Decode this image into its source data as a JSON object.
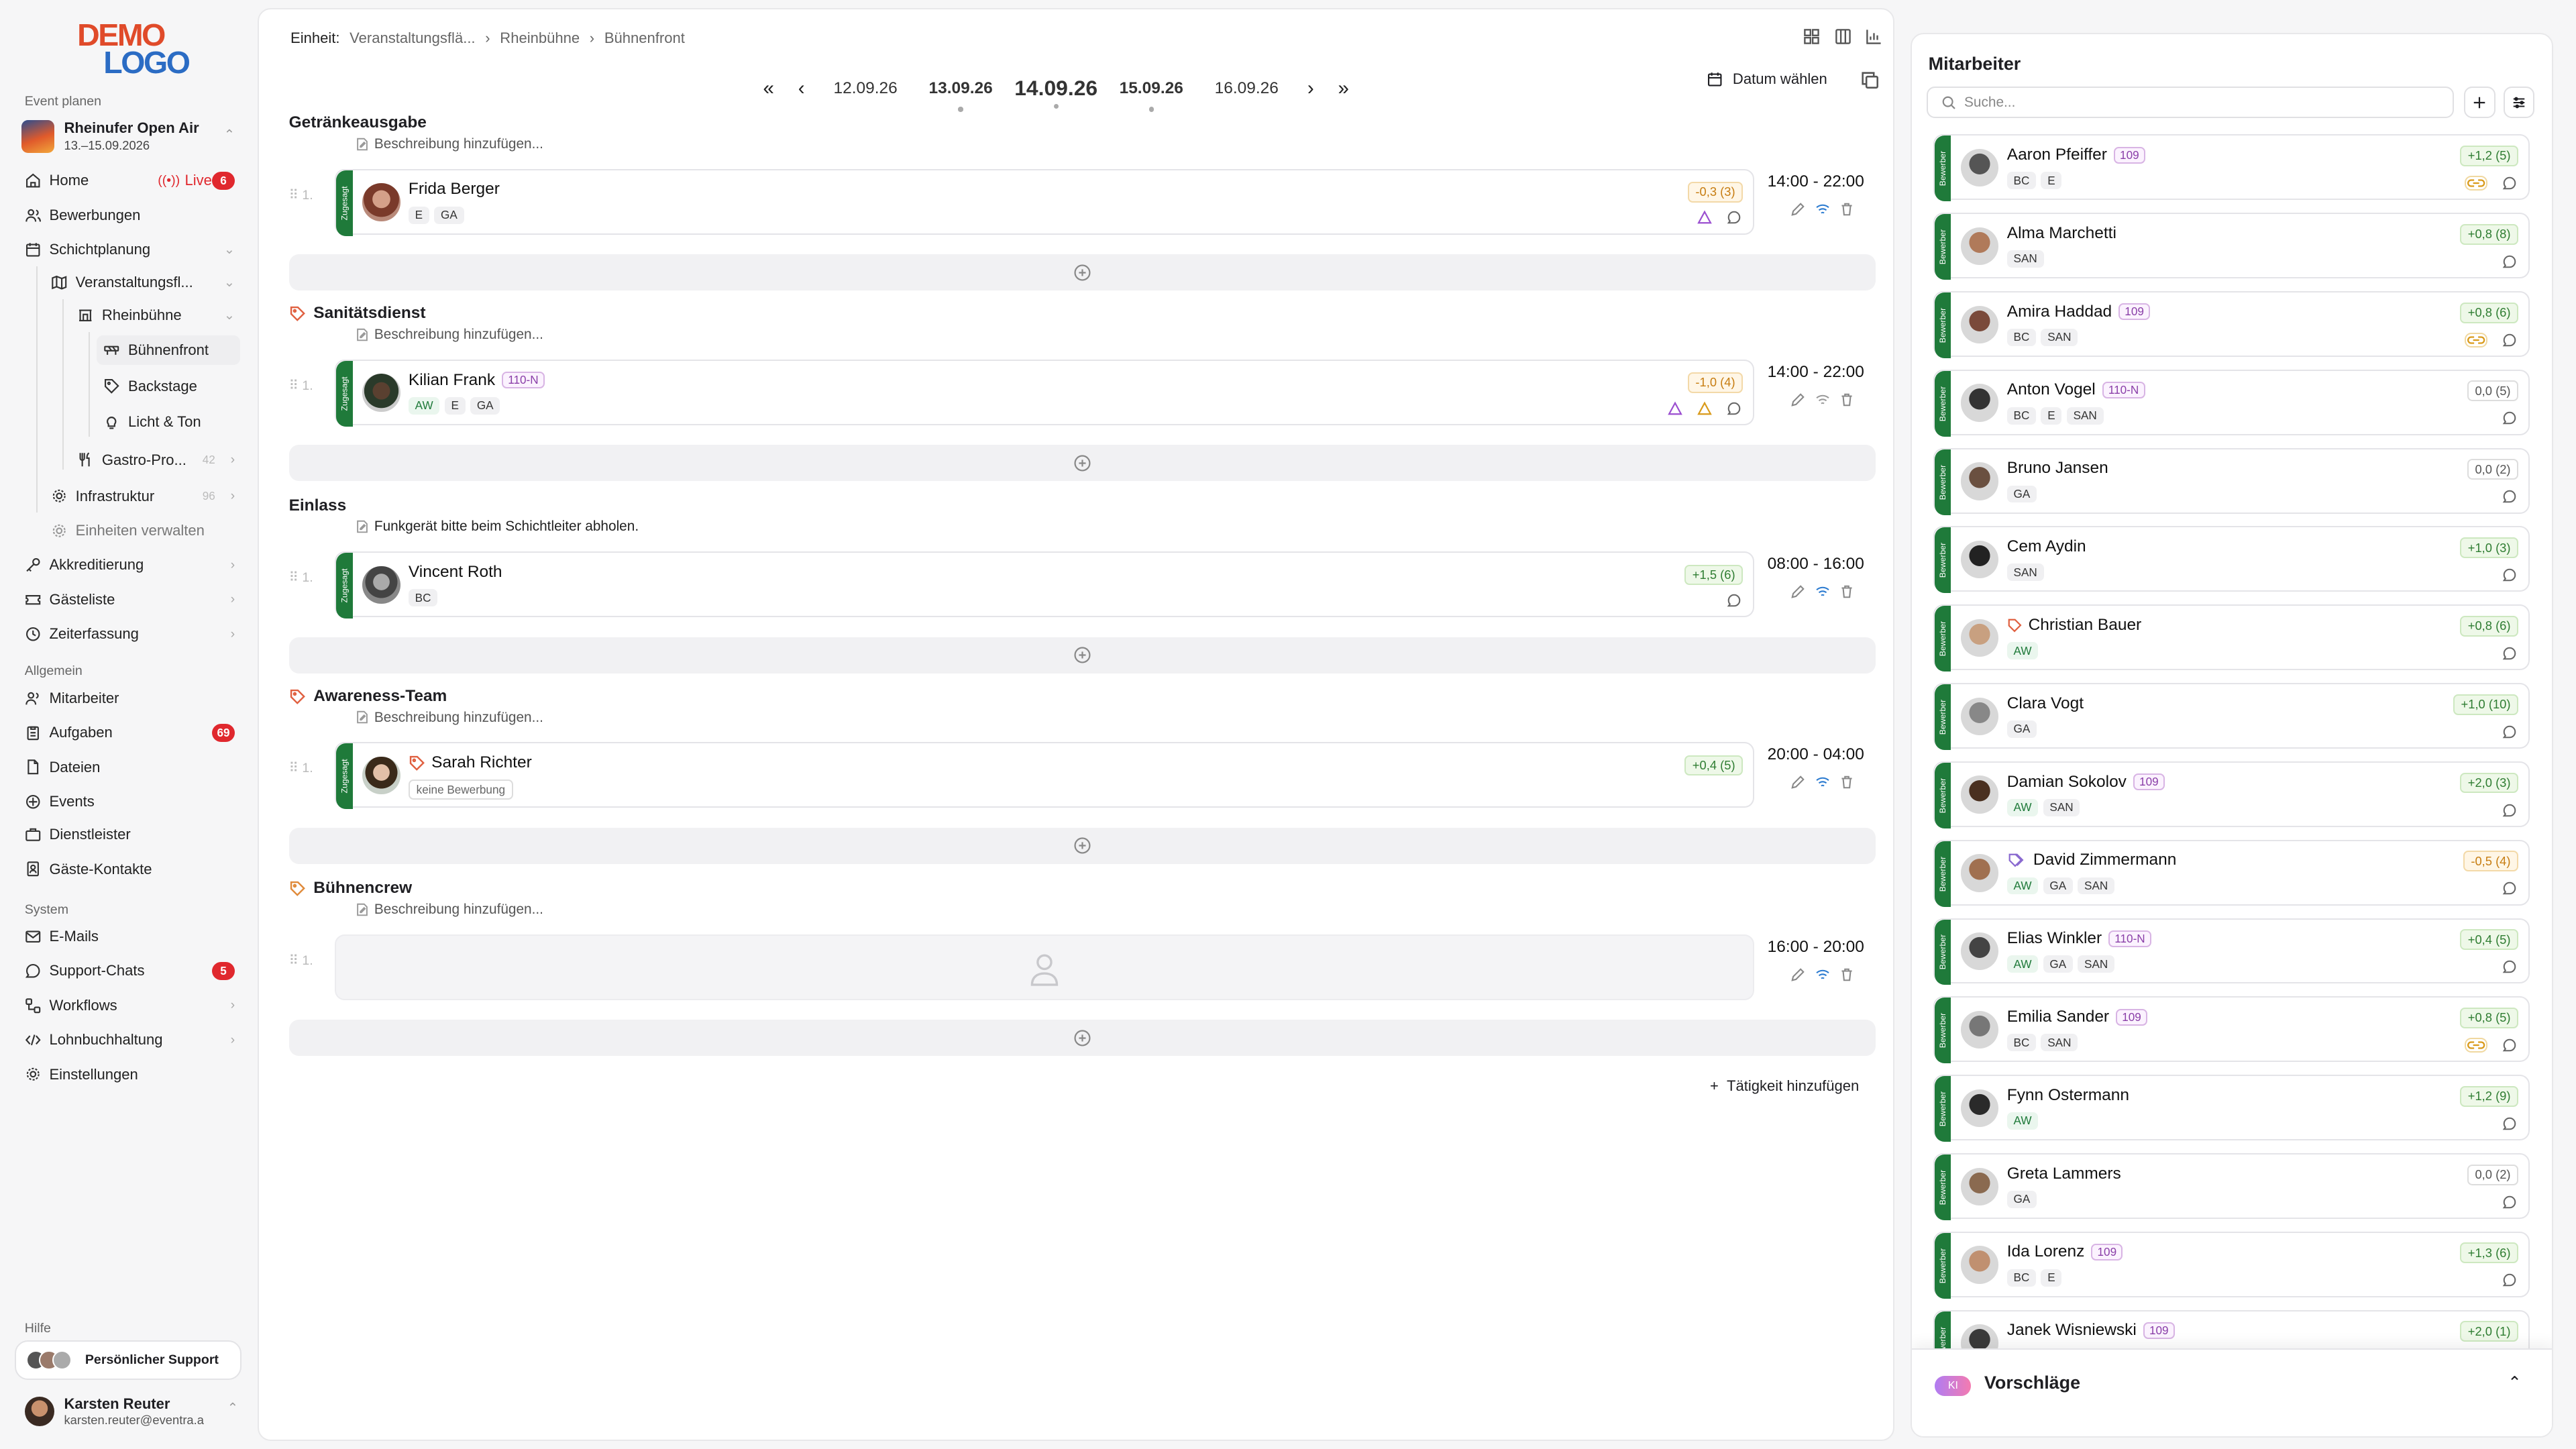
{
  "logo": {
    "line1": "DEMO",
    "line2": "LOGO"
  },
  "sidebar": {
    "plan_label": "Event planen",
    "event": {
      "title": "Rheinufer Open Air",
      "dates": "13.–15.09.2026"
    },
    "items": [
      {
        "label": "Home",
        "live": "Live",
        "badge": "6"
      },
      {
        "label": "Bewerbungen"
      },
      {
        "label": "Schichtplanung"
      },
      {
        "label": "Veranstaltungsfl..."
      },
      {
        "label": "Rheinbühne"
      },
      {
        "label": "Bühnenfront"
      },
      {
        "label": "Backstage"
      },
      {
        "label": "Licht & Ton"
      },
      {
        "label": "Gastro-Pro...",
        "count": "42"
      },
      {
        "label": "Infrastruktur",
        "count": "96"
      },
      {
        "label": "Einheiten verwalten"
      },
      {
        "label": "Akkreditierung"
      },
      {
        "label": "Gästeliste"
      },
      {
        "label": "Zeiterfassung"
      }
    ],
    "general_label": "Allgemein",
    "general": [
      {
        "label": "Mitarbeiter"
      },
      {
        "label": "Aufgaben",
        "badge": "69"
      },
      {
        "label": "Dateien"
      },
      {
        "label": "Events"
      },
      {
        "label": "Dienstleister"
      },
      {
        "label": "Gäste-Kontakte"
      }
    ],
    "system_label": "System",
    "system": [
      {
        "label": "E-Mails"
      },
      {
        "label": "Support-Chats",
        "badge": "5"
      },
      {
        "label": "Workflows"
      },
      {
        "label": "Lohnbuchhaltung"
      },
      {
        "label": "Einstellungen"
      }
    ],
    "help_label": "Hilfe",
    "support": "Persönlicher Support",
    "user": {
      "name": "Karsten Reuter",
      "email": "karsten.reuter@eventra.a"
    }
  },
  "breadcrumb": {
    "label": "Einheit:",
    "c1": "Veranstaltungsflä...",
    "c2": "Rheinbühne",
    "c3": "Bühnenfront"
  },
  "dates": [
    "12.09.26",
    "13.09.26",
    "14.09.26",
    "15.09.26",
    "16.09.26"
  ],
  "date_pick": "Datum wählen",
  "strip_label": "Zugesagt",
  "groups": [
    {
      "title": "Getränkeausgabe",
      "desc": "Beschreibung hinzufügen...",
      "name": "Frida Berger",
      "badges": [
        "E",
        "GA"
      ],
      "score": "-0,3 (3)",
      "time": "14:00  -  22:00"
    },
    {
      "title": "Sanitätsdienst",
      "desc": "Beschreibung hinzufügen...",
      "name": "Kilian Frank",
      "pbadge": "110-N",
      "badges": [
        "AW",
        "E",
        "GA"
      ],
      "score": "-1,0 (4)",
      "time": "14:00  -  22:00"
    },
    {
      "title": "Einlass",
      "desc": "Funkgerät bitte beim Schichtleiter abholen.",
      "name": "Vincent Roth",
      "badges": [
        "BC"
      ],
      "score": "+1,5 (6)",
      "time": "08:00  -  16:00"
    },
    {
      "title": "Awareness-Team",
      "desc": "Beschreibung hinzufügen...",
      "name": "Sarah Richter",
      "badges": [
        "keine Bewerbung"
      ],
      "score": "+0,4 (5)",
      "time": "20:00  -  04:00"
    },
    {
      "title": "Bühnencrew",
      "desc": "Beschreibung hinzufügen...",
      "time": "16:00  -  20:00"
    }
  ],
  "row_number": "1.",
  "add_activity": "Tätigkeit hinzufügen",
  "right": {
    "title": "Mitarbeiter",
    "search_placeholder": "Suche...",
    "strip_label": "Bewerber",
    "employees": [
      {
        "name": "Aaron Pfeiffer",
        "p": "109",
        "badges": [
          "BC",
          "E"
        ],
        "score": "+1,2 (5)"
      },
      {
        "name": "Alma Marchetti",
        "badges": [
          "SAN"
        ],
        "score": "+0,8 (8)"
      },
      {
        "name": "Amira Haddad",
        "p": "109",
        "badges": [
          "BC",
          "SAN"
        ],
        "score": "+0,8 (6)"
      },
      {
        "name": "Anton Vogel",
        "p": "110-N",
        "badges": [
          "BC",
          "E",
          "SAN"
        ],
        "score": "0,0 (5)"
      },
      {
        "name": "Bruno Jansen",
        "badges": [
          "GA"
        ],
        "score": "0,0 (2)"
      },
      {
        "name": "Cem Aydin",
        "badges": [
          "SAN"
        ],
        "score": "+1,0 (3)"
      },
      {
        "name": "Christian Bauer",
        "badges": [
          "AW"
        ],
        "score": "+0,8 (6)"
      },
      {
        "name": "Clara Vogt",
        "badges": [
          "GA"
        ],
        "score": "+1,0 (10)"
      },
      {
        "name": "Damian Sokolov",
        "p": "109",
        "badges": [
          "AW",
          "SAN"
        ],
        "score": "+2,0 (3)"
      },
      {
        "name": "David Zimmermann",
        "badges": [
          "AW",
          "GA",
          "SAN"
        ],
        "score": "-0,5 (4)"
      },
      {
        "name": "Elias Winkler",
        "p": "110-N",
        "badges": [
          "AW",
          "GA",
          "SAN"
        ],
        "score": "+0,4 (5)"
      },
      {
        "name": "Emilia Sander",
        "p": "109",
        "badges": [
          "BC",
          "SAN"
        ],
        "score": "+0,8 (5)"
      },
      {
        "name": "Fynn Ostermann",
        "badges": [
          "AW"
        ],
        "score": "+1,2 (9)"
      },
      {
        "name": "Greta Lammers",
        "badges": [
          "GA"
        ],
        "score": "0,0 (2)"
      },
      {
        "name": "Ida Lorenz",
        "p": "109",
        "badges": [
          "BC",
          "E"
        ],
        "score": "+1,3 (6)"
      },
      {
        "name": "Janek Wisniewski",
        "p": "109",
        "badges": [],
        "score": "+2,0 (1)"
      }
    ],
    "ki_label": "KI",
    "suggestions": "Vorschläge"
  },
  "colors": {
    "accent_green": "#1f7a3a",
    "badge_red": "#e0282e",
    "purple_badge": "#8a3fa8"
  }
}
